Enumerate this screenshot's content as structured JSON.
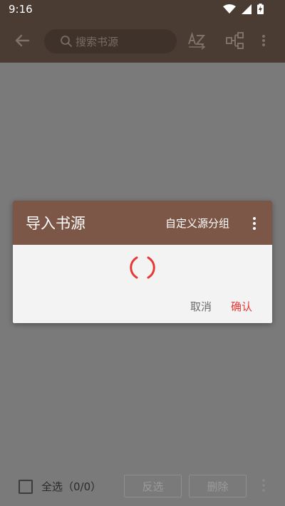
{
  "status": {
    "time": "9:16"
  },
  "toolbar": {
    "search_placeholder": "搜索书源"
  },
  "bottom": {
    "select_all_label": "全选（0/0）",
    "invert_label": "反选",
    "delete_label": "删除"
  },
  "dialog": {
    "title": "导入书源",
    "custom_group_label": "自定义源分组",
    "cancel_label": "取消",
    "confirm_label": "确认"
  },
  "colors": {
    "toolbar_bg": "#4a3b33",
    "dialog_header": "#7c5646",
    "accent": "#e53935",
    "overlay": "#7a7a7a"
  }
}
